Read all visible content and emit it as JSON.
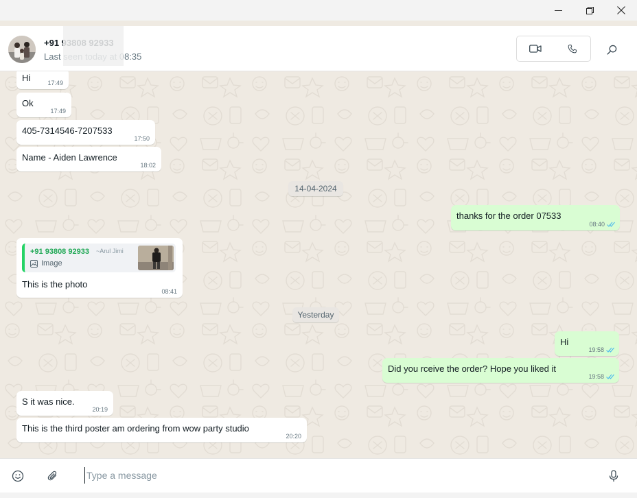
{
  "window": {
    "minimize_icon": "minimize-icon",
    "maximize_icon": "restore-icon",
    "close_icon": "close-icon"
  },
  "header": {
    "contact_name": "+91 93808 92933",
    "status": "Last seen today at 08:35",
    "video_icon": "video-camera-icon",
    "call_icon": "phone-icon",
    "search_icon": "search-icon"
  },
  "messages": [
    {
      "dir": "in",
      "text": "Hi",
      "time": "17:49"
    },
    {
      "dir": "in",
      "text": "Ok",
      "time": "17:49"
    },
    {
      "dir": "in",
      "text": "405-7314546-7207533",
      "time": "17:50"
    },
    {
      "dir": "in",
      "text": "Name - Aiden Lawrence",
      "time": "18:02"
    },
    {
      "dir": "date",
      "text": "14-04-2024"
    },
    {
      "dir": "out",
      "text": "thanks for the order 07533",
      "time": "08:40"
    },
    {
      "dir": "in",
      "text": "This is the photo",
      "time": "08:41",
      "quote": {
        "sender": "+91 93808 92933",
        "author": "~Arul Jimi",
        "type": "Image"
      }
    },
    {
      "dir": "date",
      "text": "Yesterday"
    },
    {
      "dir": "out",
      "text": "Hi",
      "time": "19:58"
    },
    {
      "dir": "out",
      "text": "Did you rceive the order? Hope you liked it",
      "time": "19:58"
    },
    {
      "dir": "in",
      "text": "S it was nice.",
      "time": "20:19"
    },
    {
      "dir": "in",
      "text": "This is the third poster am ordering from wow party studio",
      "time": "20:20"
    }
  ],
  "composer": {
    "placeholder": "Type a message",
    "emoji_icon": "emoji-icon",
    "attach_icon": "paperclip-icon",
    "mic_icon": "microphone-icon"
  },
  "colors": {
    "incoming": "#ffffff",
    "outgoing": "#d9fdd3",
    "chat_bg": "#efeae2",
    "read_ticks": "#53bdeb",
    "quote_bar": "#25d366"
  }
}
